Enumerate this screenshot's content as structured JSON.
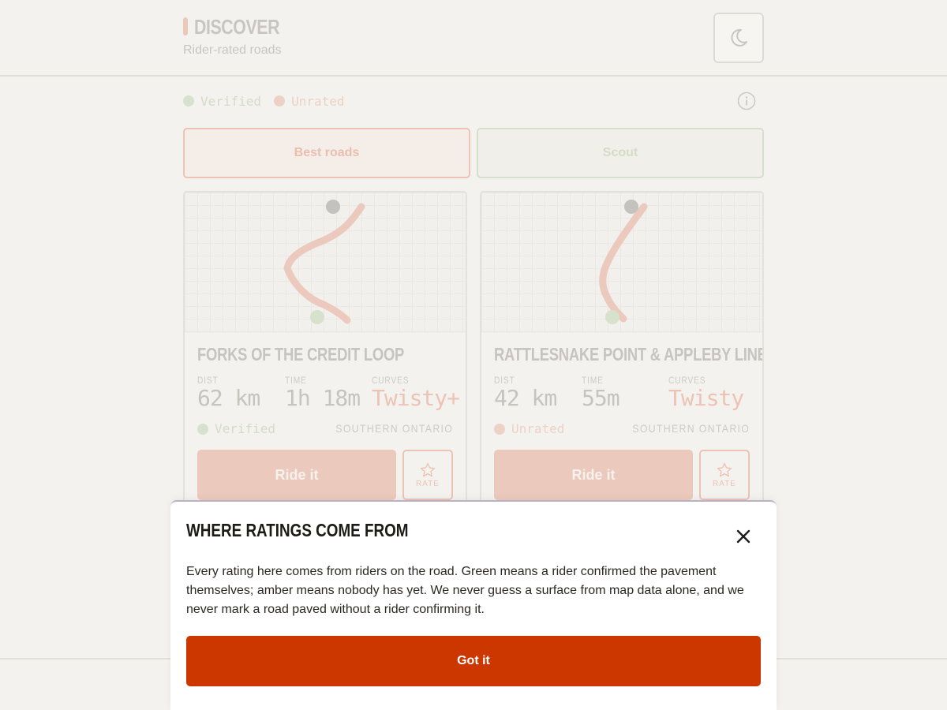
{
  "header": {
    "title": "DISCOVER",
    "subtitle": "Rider-rated roads",
    "theme_icon": "moon-icon"
  },
  "legend": {
    "verified_label": "Verified",
    "unrated_label": "Unrated",
    "info_icon": "info-icon"
  },
  "tabs": [
    {
      "label": "Best roads"
    },
    {
      "label": "Scout"
    }
  ],
  "cards": [
    {
      "name": "FORKS OF THE CREDIT LOOP",
      "dist_label": "DIST",
      "dist_value": "62 km",
      "time_label": "TIME",
      "time_value": "1h 18m",
      "curves_label": "CURVES",
      "curves_value": "Twisty+",
      "status": "Verified",
      "status_color": "#d7e1cc",
      "region": "SOUTHERN ONTARIO",
      "ride_label": "Ride it",
      "rate_label": "RATE"
    },
    {
      "name": "RATTLESNAKE POINT & APPLEBY LINE",
      "dist_label": "DIST",
      "dist_value": "42 km",
      "time_label": "TIME",
      "time_value": "55m",
      "curves_label": "CURVES",
      "curves_value": "Twisty",
      "status": "Unrated",
      "status_color": "#ecd2c4",
      "region": "SOUTHERN ONTARIO",
      "ride_label": "Ride it",
      "rate_label": "RATE"
    }
  ],
  "sheet": {
    "title": "WHERE RATINGS COME FROM",
    "body": "Every rating here comes from riders on the road. Green means a rider confirmed the pavement themselves; amber means nobody has yet. We never guess a surface from map data alone, and we never mark a road paved without a rider confirming it.",
    "button_label": "Got it",
    "close_icon": "close-icon"
  },
  "colors": {
    "background": "#f4f2ee",
    "accent": "#cc3700",
    "verified": "#d7e1cc",
    "unrated": "#ecd2c4",
    "route": "#ecc9bd"
  }
}
